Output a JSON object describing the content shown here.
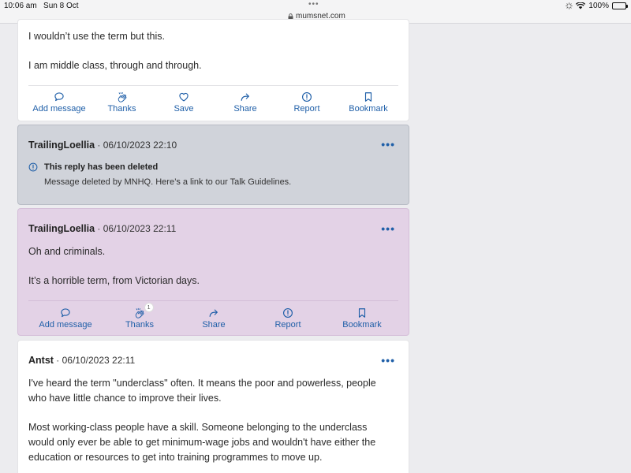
{
  "status_bar": {
    "time": "10:06 am",
    "date": "Sun 8 Oct",
    "dots": "•••",
    "url": "mumsnet.com",
    "battery": "100%"
  },
  "post1": {
    "paragraphs": [
      "I wouldn’t use the term but this.",
      "I am middle class, through and through."
    ],
    "actions": [
      "Add message",
      "Thanks",
      "Save",
      "Share",
      "Report",
      "Bookmark"
    ]
  },
  "post2": {
    "author": "TrailingLoellia",
    "timestamp": "· 06/10/2023 22:10",
    "deleted_title": "This reply has been deleted",
    "deleted_text": "Message deleted by MNHQ. Here’s a link to our Talk Guidelines."
  },
  "post3": {
    "author": "TrailingLoellia",
    "timestamp": "· 06/10/2023 22:11",
    "paragraphs": [
      "Oh and criminals.",
      "It’s a horrible term, from Victorian days."
    ],
    "thanks_count": "1",
    "actions": [
      "Add message",
      "Thanks",
      "Share",
      "Report",
      "Bookmark"
    ]
  },
  "post4": {
    "author": "Antst",
    "timestamp": "· 06/10/2023 22:11",
    "paragraphs": [
      "I've heard the term \"underclass\" often. It means the poor and powerless, people",
      "who have little chance to improve their lives.",
      "Most working-class people have a skill. Someone belonging to the underclass",
      "would only ever be able to get minimum-wage jobs and wouldn't have either the",
      "education or resources to get into training programmes to move up."
    ]
  },
  "colors": {
    "link_blue": "#1f5fa8",
    "deleted_bg": "#d0d3da",
    "highlight_bg": "#e3d2e6"
  }
}
